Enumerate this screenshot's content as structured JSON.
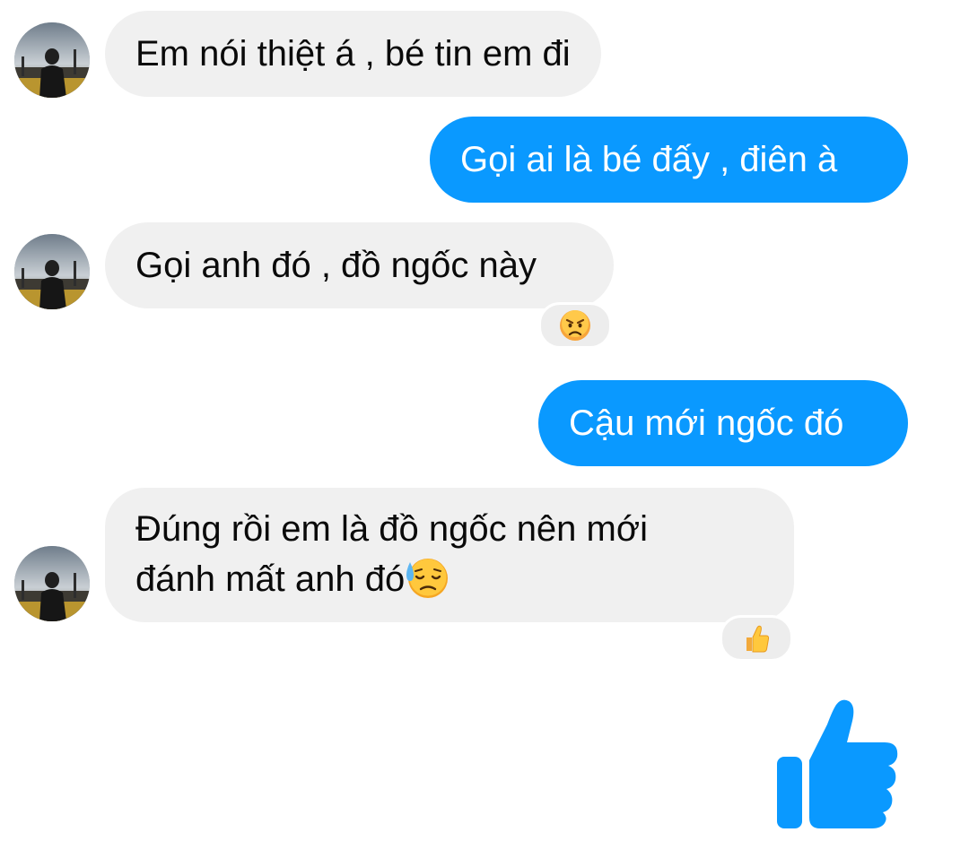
{
  "conversation": {
    "messages": [
      {
        "sender": "them",
        "text": "Em nói thiệt á , bé tin em đi"
      },
      {
        "sender": "me",
        "text": "Gọi ai là bé đấy , điên à"
      },
      {
        "sender": "them",
        "text": "Gọi anh đó , đồ ngốc này",
        "reaction": "angry-face"
      },
      {
        "sender": "me",
        "text": "Cậu mới ngốc đó"
      },
      {
        "sender": "them",
        "line1": "Đúng rồi em là đồ ngốc nên mới",
        "line2": "đánh mất anh đó",
        "inline_emoji": "downcast-face-with-sweat",
        "reaction": "thumbs-up"
      }
    ],
    "large_reaction": "thumbs-up"
  },
  "colors": {
    "outgoing_bubble": "#0a99ff",
    "incoming_bubble": "#f0f0f0",
    "like_icon": "#0a99ff"
  }
}
